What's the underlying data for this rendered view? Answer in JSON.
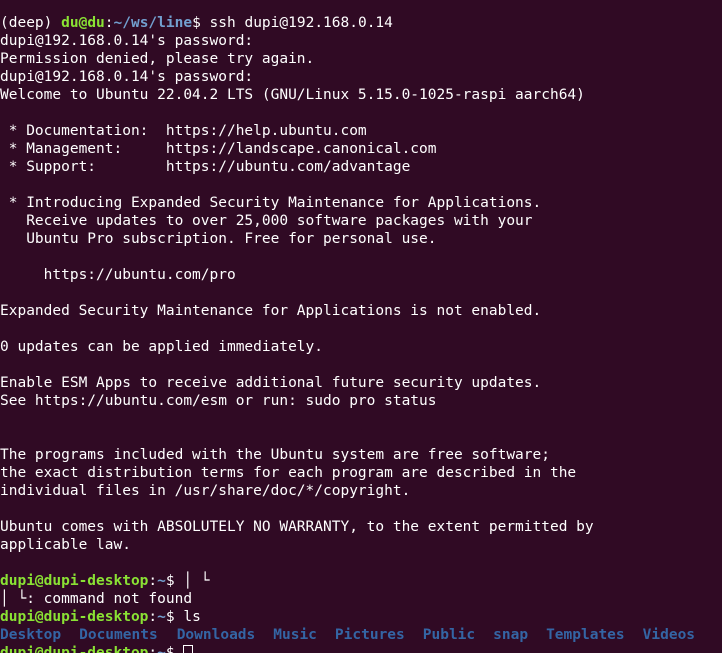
{
  "venv": "(deep)",
  "local_prompt": {
    "user_host": "du@du",
    "sep": ":",
    "path": "~/ws/line",
    "symbol": "$",
    "command": " ssh dupi@192.168.0.14"
  },
  "session_lines": [
    "dupi@192.168.0.14's password:",
    "Permission denied, please try again.",
    "dupi@192.168.0.14's password:",
    "Welcome to Ubuntu 22.04.2 LTS (GNU/Linux 5.15.0-1025-raspi aarch64)",
    "",
    " * Documentation:  https://help.ubuntu.com",
    " * Management:     https://landscape.canonical.com",
    " * Support:        https://ubuntu.com/advantage",
    "",
    " * Introducing Expanded Security Maintenance for Applications.",
    "   Receive updates to over 25,000 software packages with your",
    "   Ubuntu Pro subscription. Free for personal use.",
    "",
    "     https://ubuntu.com/pro",
    "",
    "Expanded Security Maintenance for Applications is not enabled.",
    "",
    "0 updates can be applied immediately.",
    "",
    "Enable ESM Apps to receive additional future security updates.",
    "See https://ubuntu.com/esm or run: sudo pro status",
    "",
    "",
    "The programs included with the Ubuntu system are free software;",
    "the exact distribution terms for each program are described in the",
    "individual files in /usr/share/doc/*/copyright.",
    "",
    "Ubuntu comes with ABSOLUTELY NO WARRANTY, to the extent permitted by",
    "applicable law.",
    ""
  ],
  "remote_prompt": {
    "user_host": "dupi@dupi-desktop",
    "sep": ":",
    "path": "~",
    "symbol": "$"
  },
  "cmd1": " │ └",
  "cmd1_output": "│ └: command not found",
  "cmd2": " ls",
  "ls_entries": [
    "Desktop",
    "Documents",
    "Downloads",
    "Music",
    "Pictures",
    "Public",
    "snap",
    "Templates",
    "Videos"
  ],
  "colors": {
    "background": "#300a24",
    "foreground": "#ffffff",
    "prompt_user": "#8ae234",
    "prompt_path": "#729fcf",
    "directory": "#3465a4"
  }
}
